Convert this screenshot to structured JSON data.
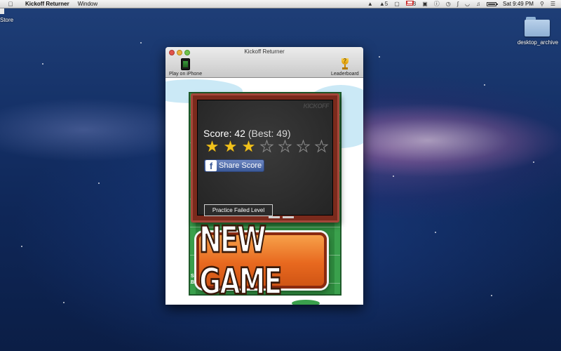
{
  "menubar": {
    "app_name": "Kickoff Returner",
    "menus": [
      "Window"
    ],
    "tray_counts": [
      "5",
      "3"
    ],
    "clock": "Sat 9:49 PM"
  },
  "desktop": {
    "store_label": "Store",
    "folder_label": "desktop_archive"
  },
  "window": {
    "title": "Kickoff Returner",
    "toolbar": {
      "play_on_iphone": "Play on iPhone",
      "leaderboard": "Leaderboard"
    }
  },
  "game": {
    "logo": "KICKOFF",
    "score_text": "Score: 42",
    "best_text": "(Best: 49)",
    "stars_earned": 3,
    "stars_total": 7,
    "share_label": "Share Score",
    "practice_label": "Practice Failed Level",
    "new_game_label": "NEW GAME",
    "side_text_1": "Sc",
    "side_text_2": "Be"
  },
  "colors": {
    "scoreboard_frame": "#7a2a1c",
    "field_green": "#2e8a3e",
    "star_gold": "#f1c21c",
    "facebook_blue": "#3b5998",
    "new_game_orange": "#e8691f"
  }
}
